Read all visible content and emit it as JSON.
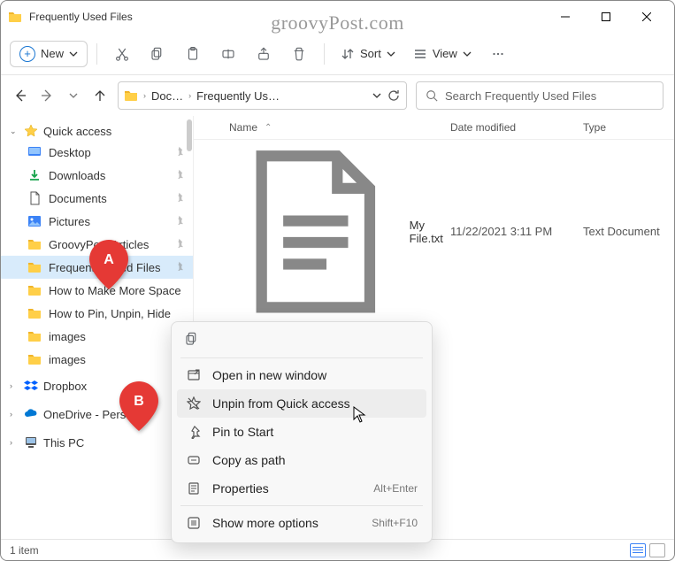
{
  "window": {
    "title": "Frequently Used Files"
  },
  "watermark": "groovyPost.com",
  "toolbar": {
    "new_label": "New",
    "sort_label": "Sort",
    "view_label": "View"
  },
  "breadcrumb": {
    "seg1": "Doc…",
    "seg2": "Frequently Us…"
  },
  "search": {
    "placeholder": "Search Frequently Used Files"
  },
  "columns": {
    "name": "Name",
    "date": "Date modified",
    "type": "Type"
  },
  "files": [
    {
      "name": "My File.txt",
      "date": "11/22/2021 3:11 PM",
      "type": "Text Document"
    }
  ],
  "sidebar": {
    "quick_access": "Quick access",
    "items": [
      {
        "label": "Desktop"
      },
      {
        "label": "Downloads"
      },
      {
        "label": "Documents"
      },
      {
        "label": "Pictures"
      },
      {
        "label": "GroovyPost Articles"
      },
      {
        "label": "Frequently Used Files"
      },
      {
        "label": "How to Make More Space"
      },
      {
        "label": "How to Pin, Unpin, Hide"
      },
      {
        "label": "images"
      },
      {
        "label": "images"
      }
    ],
    "dropbox": "Dropbox",
    "onedrive": "OneDrive - Personal",
    "thispc": "This PC"
  },
  "context_menu": {
    "open_new_window": "Open in new window",
    "unpin": "Unpin from Quick access",
    "pin_start": "Pin to Start",
    "copy_path": "Copy as path",
    "properties": "Properties",
    "properties_shortcut": "Alt+Enter",
    "show_more": "Show more options",
    "show_more_shortcut": "Shift+F10"
  },
  "status": {
    "count": "1 item"
  },
  "markers": {
    "a": "A",
    "b": "B"
  }
}
